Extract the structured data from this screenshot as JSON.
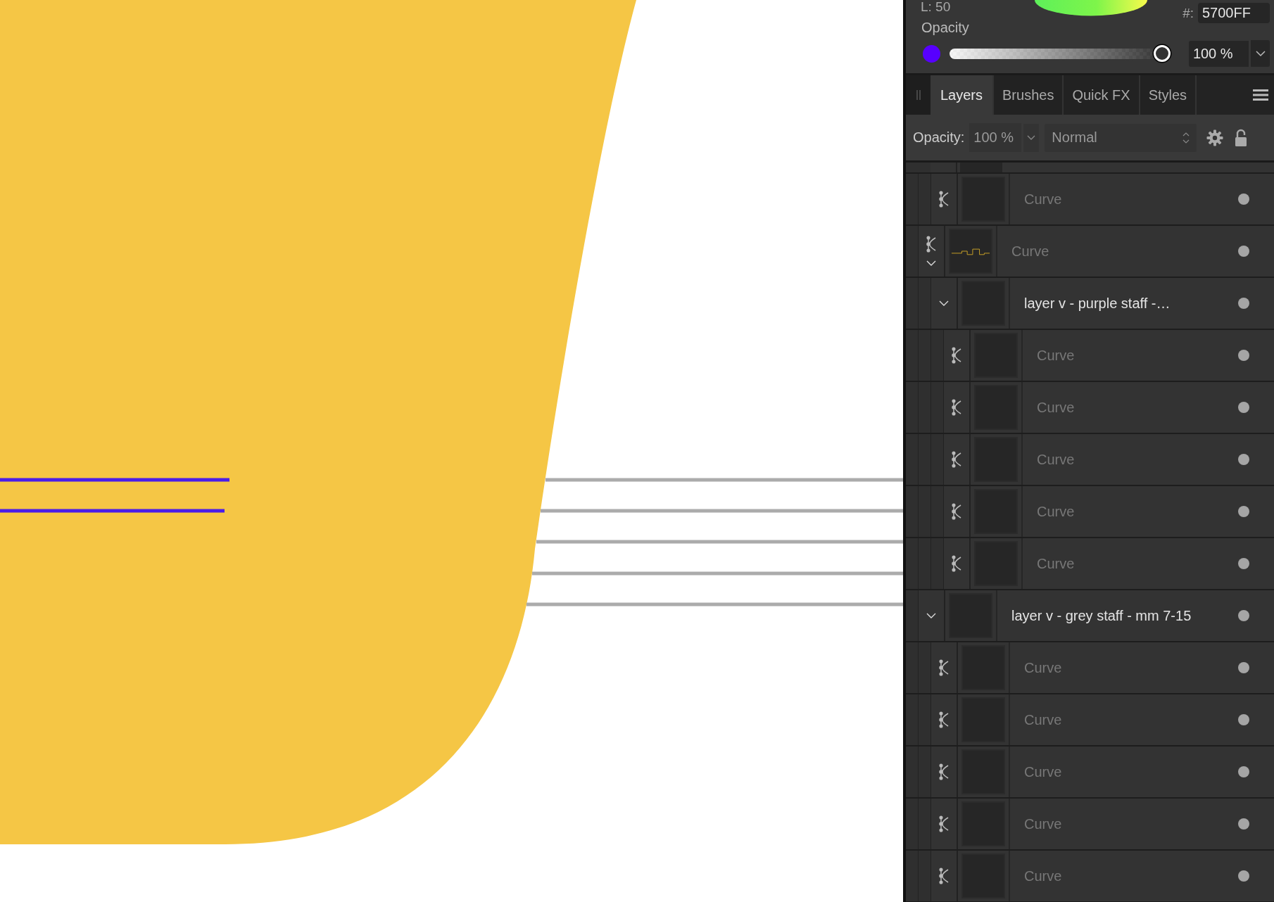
{
  "color_panel": {
    "lightness_label": "L: 50",
    "hex_label": "#:",
    "hex_value": "5700FF",
    "opacity_label": "Opacity",
    "level": 1.0,
    "opacity_value": "100 %"
  },
  "tabs": [
    {
      "label": "Layers",
      "selected": true
    },
    {
      "label": "Brushes",
      "selected": false
    },
    {
      "label": "Quick FX",
      "selected": false
    },
    {
      "label": "Styles",
      "selected": false
    }
  ],
  "layer_toolbar": {
    "opacity_label": "Opacity:",
    "opacity_value": "100 %",
    "blend_mode": "Normal"
  },
  "layers": [
    {
      "children": [
        {
          "kind": "curve",
          "name": "Curve"
        }
      ]
    },
    {
      "kind": "curve",
      "name": "Curve",
      "expanded": true,
      "children": [
        {
          "kind": "group",
          "name": "layer v - purple staff -…",
          "expanded": true,
          "children": [
            {
              "kind": "curve",
              "name": "Curve"
            },
            {
              "kind": "curve",
              "name": "Curve"
            },
            {
              "kind": "curve",
              "name": "Curve"
            },
            {
              "kind": "curve",
              "name": "Curve"
            },
            {
              "kind": "curve",
              "name": "Curve"
            }
          ]
        }
      ]
    },
    {
      "kind": "group",
      "name": "layer v - grey staff - mm 7-15",
      "expanded": true,
      "children": [
        {
          "kind": "curve",
          "name": "Curve"
        },
        {
          "kind": "curve",
          "name": "Curve"
        },
        {
          "kind": "curve",
          "name": "Curve"
        },
        {
          "kind": "curve",
          "name": "Curve"
        },
        {
          "kind": "curve",
          "name": "Curve"
        }
      ]
    }
  ]
}
